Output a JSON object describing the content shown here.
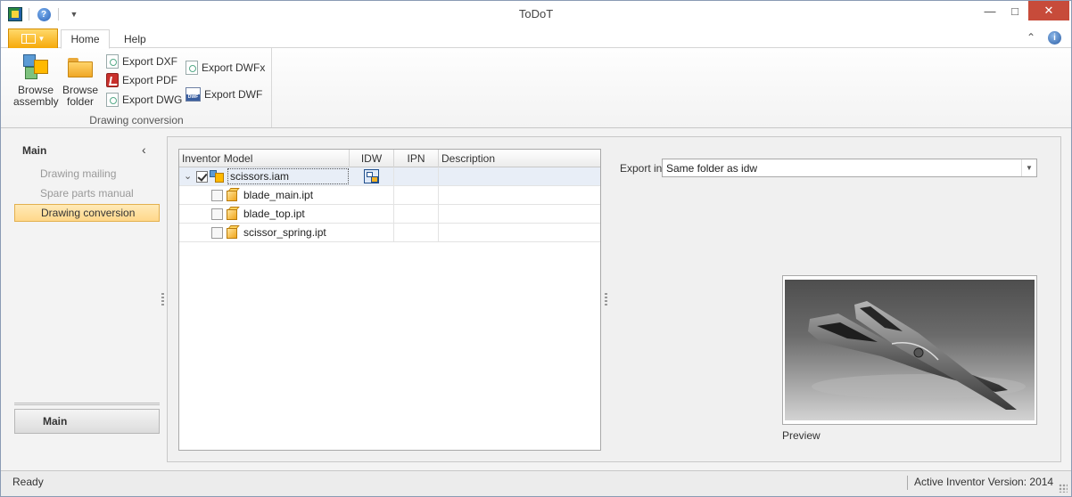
{
  "window": {
    "title": "ToDoT"
  },
  "ribbon": {
    "tabs": [
      {
        "label": "Home",
        "active": true
      },
      {
        "label": "Help",
        "active": false
      }
    ],
    "group": {
      "label": "Drawing conversion",
      "browse_assembly": "Browse assembly",
      "browse_folder": "Browse folder",
      "export_dxf": "Export DXF",
      "export_pdf": "Export PDF",
      "export_dwg": "Export DWG",
      "export_dwfx": "Export DWFx",
      "export_dwf": "Export DWF"
    }
  },
  "nav": {
    "header": "Main",
    "items": [
      {
        "label": "Drawing mailing",
        "active": false
      },
      {
        "label": "Spare parts manual",
        "active": false
      },
      {
        "label": "Drawing conversion",
        "active": true
      }
    ],
    "main_button": "Main"
  },
  "grid": {
    "columns": [
      "Inventor Model",
      "IDW",
      "IPN",
      "Description"
    ],
    "rows": [
      {
        "name": "scissors.iam",
        "checked": true,
        "level": 0,
        "has_idw": true,
        "selected": true
      },
      {
        "name": "blade_main.ipt",
        "checked": false,
        "level": 1,
        "has_idw": false
      },
      {
        "name": "blade_top.ipt",
        "checked": false,
        "level": 1,
        "has_idw": false
      },
      {
        "name": "scissor_spring.ipt",
        "checked": false,
        "level": 1,
        "has_idw": false
      }
    ]
  },
  "export": {
    "label": "Export in",
    "value": "Same folder as idw"
  },
  "preview": {
    "label": "Preview"
  },
  "status": {
    "left": "Ready",
    "right": "Active Inventor Version: 2014"
  },
  "colors": {
    "accent": "#f6a90a",
    "nav_active": "#ffd88a",
    "close_button": "#c74b3a"
  }
}
